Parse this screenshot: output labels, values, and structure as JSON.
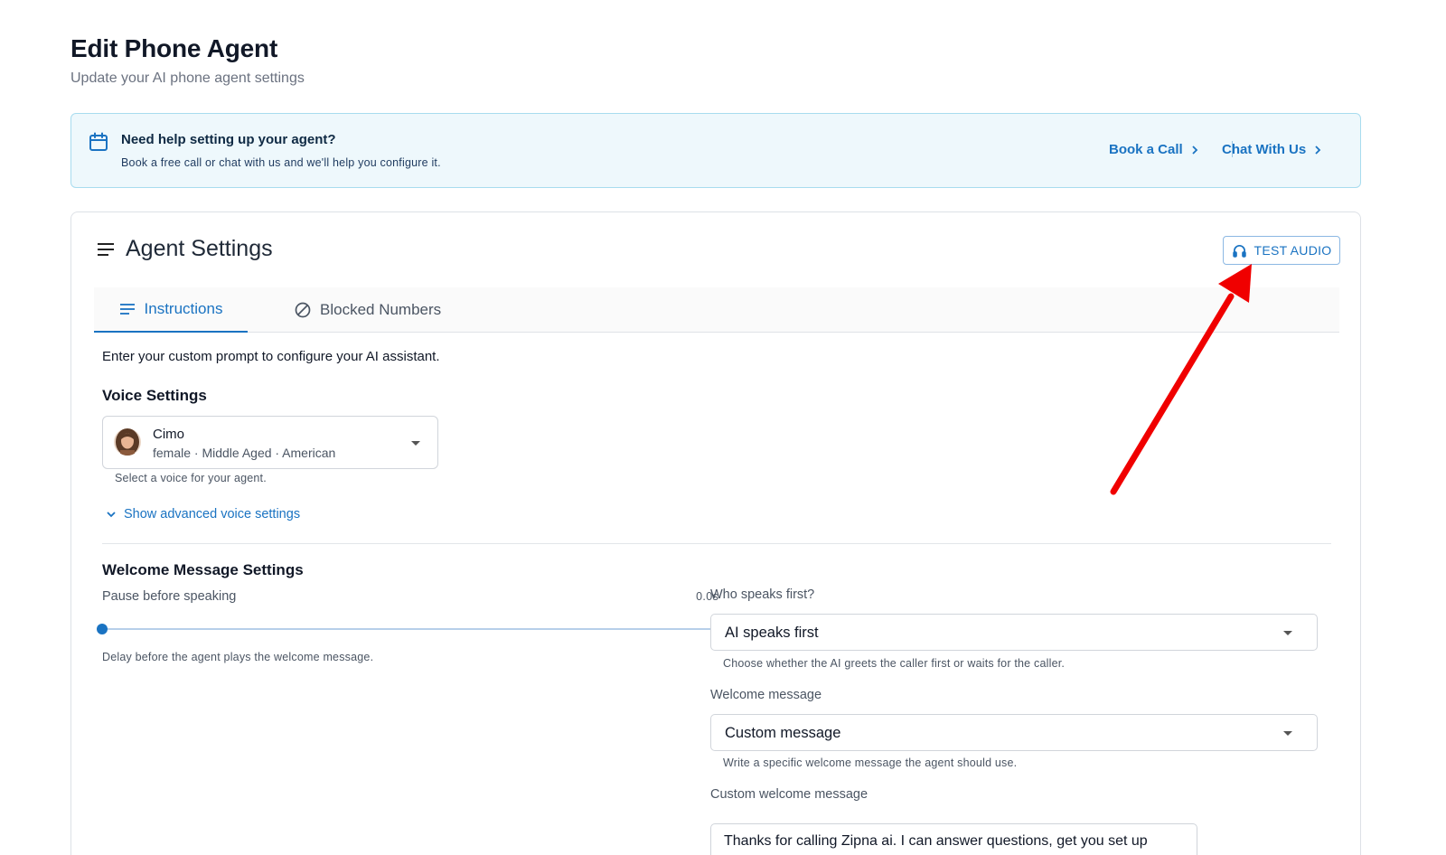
{
  "page": {
    "title": "Edit Phone Agent",
    "subtitle": "Update your AI phone agent settings"
  },
  "help_banner": {
    "icon": "calendar-icon",
    "title": "Need help setting up your agent?",
    "text": "Book a free call or chat with us and we'll help you configure it.",
    "book_call_label": "Book a Call",
    "chat_label": "Chat With Us"
  },
  "agent_settings": {
    "title": "Agent Settings",
    "test_audio_label": "TEST AUDIO",
    "tabs": [
      {
        "label": "Instructions",
        "icon": "list-icon",
        "active": true
      },
      {
        "label": "Blocked Numbers",
        "icon": "block-icon",
        "active": false
      }
    ],
    "intro": "Enter your custom prompt to configure your AI assistant.",
    "voice": {
      "section_title": "Voice Settings",
      "selected_name": "Cimo",
      "selected_meta": "female · Middle Aged · American",
      "helper": "Select a voice for your agent.",
      "advanced_link": "Show advanced voice settings"
    },
    "welcome": {
      "section_title": "Welcome Message Settings",
      "pause_label": "Pause before speaking",
      "pause_value": "0.0s",
      "pause_fraction": 0,
      "pause_helper": "Delay before the agent plays the welcome message.",
      "who_speaks_label": "Who speaks first?",
      "who_speaks_value": "AI speaks first",
      "who_speaks_helper": "Choose whether the AI greets the caller first or waits for the caller.",
      "message_label": "Welcome message",
      "message_value": "Custom message",
      "message_helper": "Write a specific welcome message the agent should use.",
      "custom_label": "Custom welcome message",
      "custom_value": "Thanks for calling Zipna ai. I can answer questions, get you set up"
    }
  },
  "colors": {
    "accent": "#1a73c2",
    "banner_bg": "#eef8fc",
    "annotation_arrow": "#f00000"
  }
}
